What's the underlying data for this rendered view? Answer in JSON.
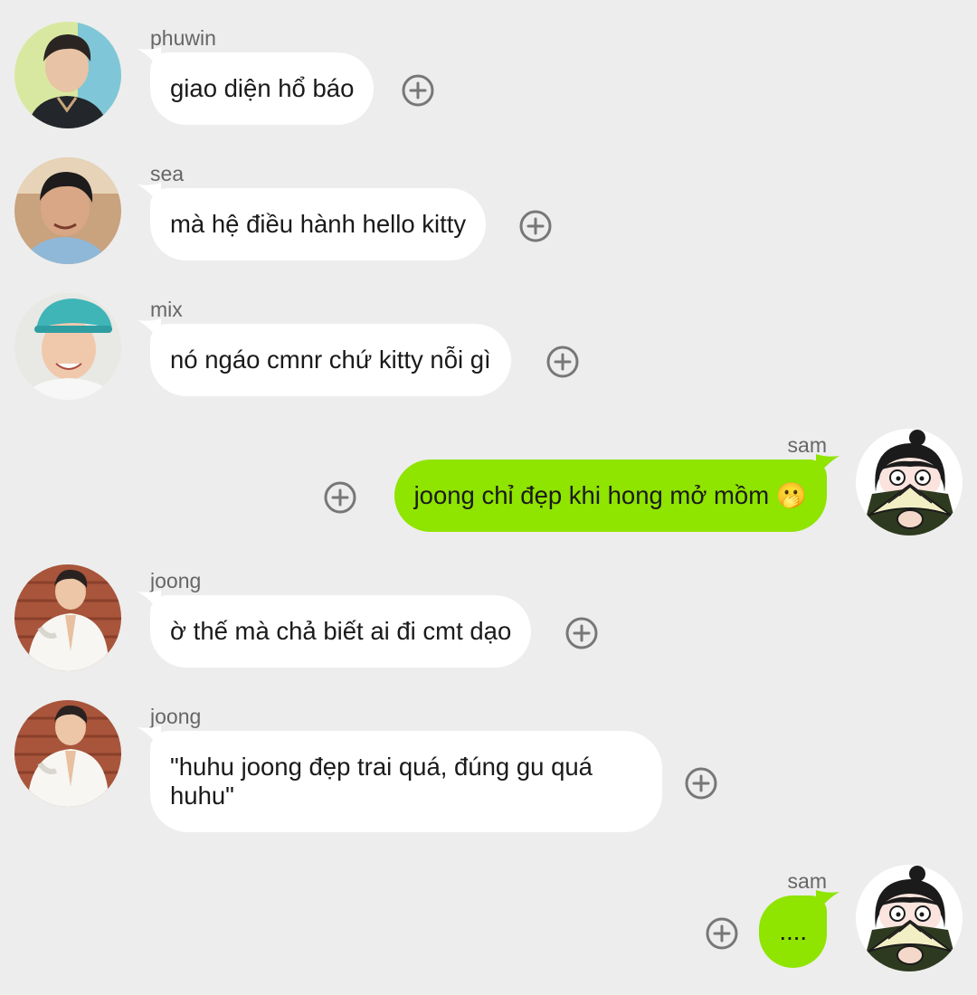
{
  "colors": {
    "background": "#ededed",
    "incoming_bubble": "#ffffff",
    "outgoing_bubble": "#8fe400",
    "text": "#1a1a1a",
    "sender_name": "#666666",
    "plus_icon": "#777777"
  },
  "messages": [
    {
      "sender": "phuwin",
      "direction": "incoming",
      "text": "giao diện hổ báo",
      "avatar": "photo-avatar"
    },
    {
      "sender": "sea",
      "direction": "incoming",
      "text": "mà hệ điều hành hello kitty",
      "avatar": "photo-avatar"
    },
    {
      "sender": "mix",
      "direction": "incoming",
      "text": "nó ngáo cmnr chứ kitty nỗi gì",
      "avatar": "photo-avatar"
    },
    {
      "sender": "sam",
      "direction": "outgoing",
      "text": "joong chỉ đẹp khi hong mở mồm 🫢",
      "avatar": "cartoon-fan-avatar"
    },
    {
      "sender": "joong",
      "direction": "incoming",
      "text": "ờ thế mà chả biết ai đi cmt dạo",
      "avatar": "photo-avatar"
    },
    {
      "sender": "joong",
      "direction": "incoming",
      "text": "\"huhu joong đẹp trai quá, đúng gu quá huhu\"",
      "avatar": "photo-avatar"
    },
    {
      "sender": "sam",
      "direction": "outgoing",
      "text": "....",
      "avatar": "cartoon-fan-avatar"
    }
  ],
  "icons": {
    "react": "plus-circle-icon"
  }
}
